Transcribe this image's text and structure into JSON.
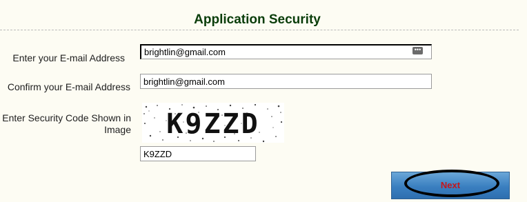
{
  "page": {
    "title": "Application Security"
  },
  "form": {
    "email_label": "Enter your E-mail Address",
    "email_value": "brightlin@gmail.com",
    "confirm_label": "Confirm your E-mail Address",
    "confirm_value": "brightlin@gmail.com",
    "security_label": "Enter Security Code Shown in Image",
    "captcha_text": "K9ZZD",
    "security_value": "K9ZZD",
    "next_label": "Next"
  },
  "colors": {
    "background": "#fdfcf3",
    "title": "#0a3d0a",
    "button": "#3a7fc0",
    "button_text": "#c4161c"
  },
  "icons": {
    "password_manager": "password-manager-icon"
  }
}
